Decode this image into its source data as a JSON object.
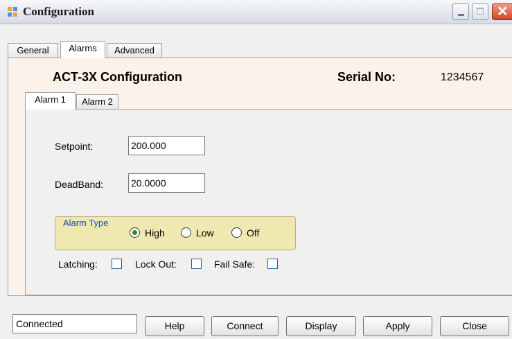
{
  "window": {
    "title": "Configuration",
    "controls": [
      "minimize-icon",
      "maximize-icon",
      "close-icon"
    ]
  },
  "tabs": [
    {
      "label": "General",
      "active": false
    },
    {
      "label": "Alarms",
      "active": true
    },
    {
      "label": "Advanced",
      "active": false
    }
  ],
  "header": {
    "title": "ACT-3X Configuration",
    "serial_label": "Serial No:",
    "serial_value": "1234567"
  },
  "alarm_tabs": [
    {
      "label": "Alarm 1",
      "active": true
    },
    {
      "label": "Alarm 2",
      "active": false
    }
  ],
  "alarm": {
    "setpoint_label": "Setpoint:",
    "setpoint_value": "200.000",
    "deadband_label": "DeadBand:",
    "deadband_value": "20.0000",
    "type_group_title": "Alarm Type",
    "type_options": [
      {
        "label": "High",
        "selected": true
      },
      {
        "label": "Low",
        "selected": false
      },
      {
        "label": "Off",
        "selected": false
      }
    ],
    "checkboxes": [
      {
        "label": "Latching:",
        "checked": false
      },
      {
        "label": "Lock Out:",
        "checked": false
      },
      {
        "label": "Fail Safe:",
        "checked": false
      }
    ]
  },
  "footer": {
    "status": "Connected",
    "buttons": [
      "Help",
      "Connect",
      "Display",
      "Apply",
      "Close"
    ]
  },
  "colors": {
    "header_bg": "#fbf2eb",
    "group_bg": "#efe8b0",
    "radio_selected": "#2a8a2a",
    "close_button": "#d24624"
  }
}
